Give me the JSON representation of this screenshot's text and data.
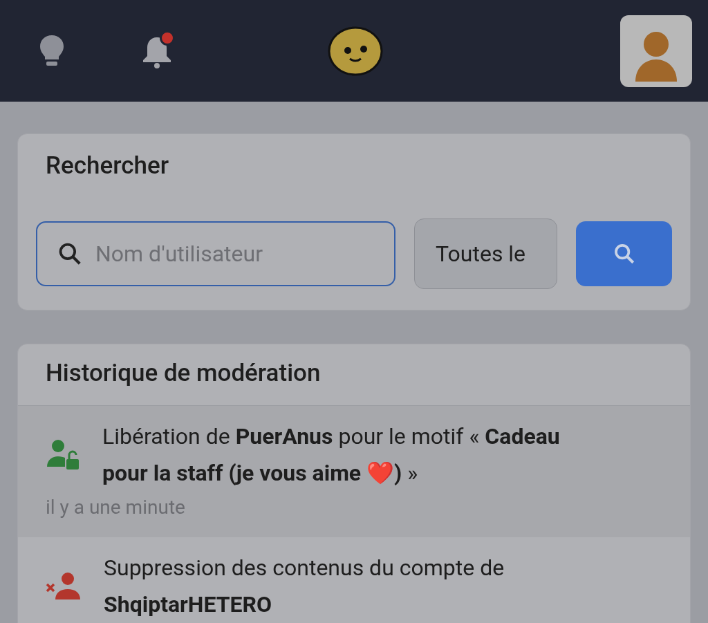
{
  "header": {
    "notifications": {
      "unread": true
    }
  },
  "search": {
    "title": "Rechercher",
    "placeholder": "Nom d'utilisateur",
    "filter": "Toutes le"
  },
  "history": {
    "title": "Historique de modération",
    "entries": [
      {
        "kind": "unban",
        "text": "Libération de **PuerAnus** pour le motif « **Cadeau pour la staff (je vous aime ❤️)** »",
        "time": "il y a une minute"
      },
      {
        "kind": "purge",
        "text": "Suppression des contenus du compte de **ShqiptarHETERO**"
      }
    ]
  }
}
